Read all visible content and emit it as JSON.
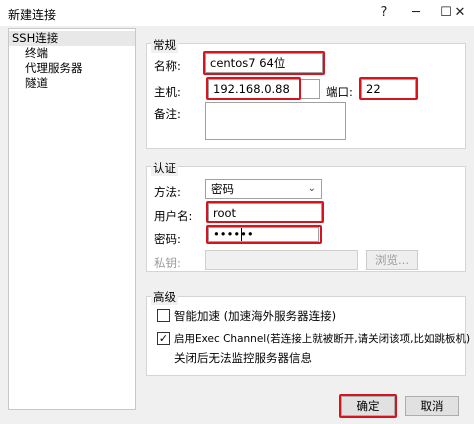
{
  "window": {
    "title": "新建连接",
    "help": "?",
    "minimize": "─",
    "maximize": "☐",
    "close": "✕"
  },
  "sidebar": {
    "root": "SSH连接",
    "children": [
      "终端",
      "代理服务器",
      "隧道"
    ]
  },
  "general": {
    "title": "常规",
    "name_label": "名称:",
    "name_value": "centos7 64位",
    "host_label": "主机:",
    "host_value": "192.168.0.88",
    "port_label": "端口:",
    "port_value": "22",
    "note_label": "备注:",
    "note_value": ""
  },
  "auth": {
    "title": "认证",
    "method_label": "方法:",
    "method_value": "密码",
    "user_label": "用户名:",
    "user_value": "root",
    "password_label": "密码:",
    "password_value": "••••••",
    "key_label": "私钥:",
    "browse_label": "浏览..."
  },
  "advanced": {
    "title": "高级",
    "smart_accel_label": "智能加速 (加速海外服务器连接)",
    "exec_channel_label": "启用Exec Channel(若连接上就被断开,请关闭该项,比如跳板机)",
    "exec_channel_note": "关闭后无法监控服务器信息",
    "smart_accel_checked": false,
    "exec_channel_checked": true
  },
  "footer": {
    "ok_label": "确定",
    "cancel_label": "取消"
  },
  "colors": {
    "highlight": "#d6141f",
    "window_bg": "#f0f0f0"
  }
}
